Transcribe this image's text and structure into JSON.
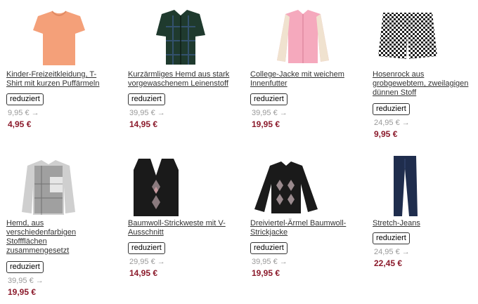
{
  "products": [
    {
      "title_lines": [
        "Kinder-Freizeitkleidung, T-",
        "Shirt mit kurzen Puffärmeln"
      ],
      "badge": "reduziert",
      "old_price": "9,95 € →",
      "new_price": "4,95 €",
      "image": "orange-puff-sleeve-tshirt-image",
      "image_color": "#f4a079"
    },
    {
      "title_lines": [
        "Kurzärmliges Hemd aus stark",
        "vorgewaschenem Leinenstoff"
      ],
      "badge": "reduziert",
      "old_price": "39,95 € →",
      "new_price": "14,95 €",
      "image": "dark-plaid-shirt-image",
      "image_color": "#1f3a2e"
    },
    {
      "title_lines": [
        "College-Jacke mit weichem",
        "Innenfutter"
      ],
      "badge": "reduziert",
      "old_price": "39,95 € →",
      "new_price": "19,95 €",
      "image": "pink-college-jacket-image",
      "image_color": "#f5a9bd"
    },
    {
      "title_lines": [
        "Hosenrock aus",
        "grobgewebtem, zweilagigen",
        "dünnen Stoff"
      ],
      "badge": "reduziert",
      "old_price": "24,95 € →",
      "new_price": "9,95 €",
      "image": "checked-culottes-image",
      "image_color": "#333333"
    },
    {
      "title_lines": [
        "Hemd, aus",
        "verschiedenfarbigen",
        "Stoffflächen",
        "zusammengesetzt"
      ],
      "badge": "reduziert",
      "old_price": "39,95 € →",
      "new_price": "19,95 €",
      "image": "grey-patchwork-shirt-image",
      "image_color": "#9a9a9a"
    },
    {
      "title_lines": [
        "Baumwoll-Strickweste mit V-",
        "Ausschnitt"
      ],
      "badge": "reduziert",
      "old_price": "29,95 € →",
      "new_price": "14,95 €",
      "image": "black-argyle-vest-image",
      "image_color": "#1a1a1a"
    },
    {
      "title_lines": [
        "Dreiviertel-Ärmel Baumwoll-",
        "Strickjacke"
      ],
      "badge": "reduziert",
      "old_price": "39,95 € →",
      "new_price": "19,95 €",
      "image": "black-argyle-cardigan-image",
      "image_color": "#1a1a1a"
    },
    {
      "title_lines": [
        "Stretch-Jeans"
      ],
      "badge": "reduziert",
      "old_price": "24,95 € →",
      "new_price": "22,45 €",
      "image": "dark-blue-jeans-image",
      "image_color": "#1f2d4d"
    }
  ]
}
